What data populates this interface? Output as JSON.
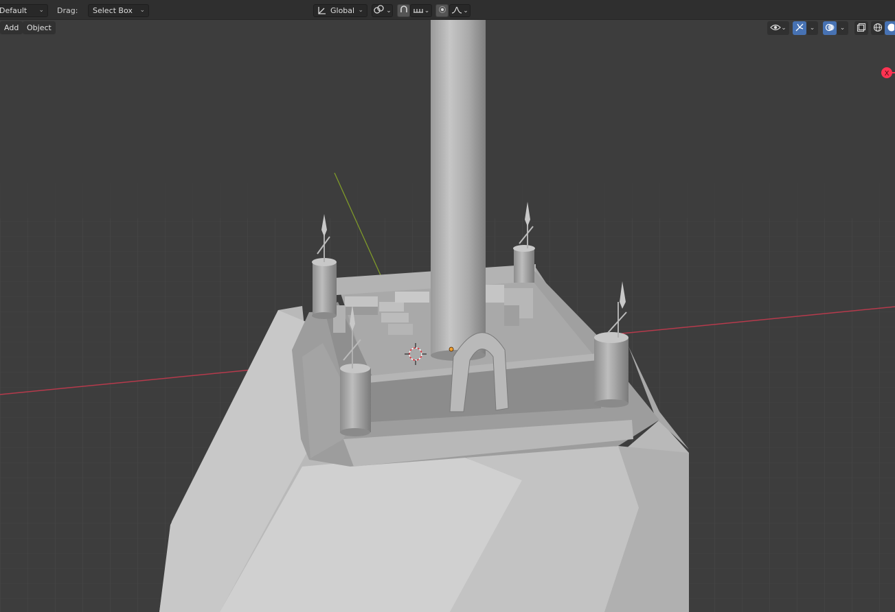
{
  "header": {
    "orientation_value": "Default",
    "drag_label": "Drag:",
    "drag_value": "Select Box",
    "transform_orientation": "Global"
  },
  "menu": {
    "add": "Add",
    "object": "Object"
  },
  "gizmo": {
    "x_axis_label": "X"
  },
  "colors": {
    "viewport_bg": "#3d3d3d",
    "header_bg": "#2f2f2f",
    "active_button": "#4772b3",
    "x_axis": "#b73a4c",
    "y_axis": "#7f9a2a",
    "gizmo_x": "#ff3352"
  },
  "icons": [
    "transform-orientation-icon",
    "pivot-point-icon",
    "snap-icon",
    "snap-increment-icon",
    "proportional-editing-icon",
    "falloff-icon",
    "visibility-icon",
    "gizmo-icon",
    "overlay-icon",
    "xray-icon",
    "wireframe-shading-icon",
    "solid-shading-icon"
  ]
}
